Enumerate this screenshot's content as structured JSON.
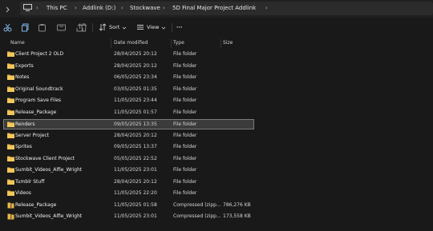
{
  "breadcrumbs": [
    "This PC",
    "Addlink (D:)",
    "Stockwave",
    "5D Final Major Project Addlink"
  ],
  "toolbar": {
    "sort_label": "Sort",
    "view_label": "View",
    "more_label": "···"
  },
  "columns": {
    "name": "Name",
    "date": "Date modified",
    "type": "Type",
    "size": "Size"
  },
  "files": [
    {
      "name": "Client Project 2 OLD",
      "date": "28/04/2025 20:12",
      "type": "File folder",
      "size": "",
      "icon": "folder-icon"
    },
    {
      "name": "Exports",
      "date": "28/04/2025 20:12",
      "type": "File folder",
      "size": "",
      "icon": "folder-icon"
    },
    {
      "name": "Notes",
      "date": "06/05/2025 23:34",
      "type": "File folder",
      "size": "",
      "icon": "folder-icon"
    },
    {
      "name": "Original Soundtrack",
      "date": "03/05/2025 01:35",
      "type": "File folder",
      "size": "",
      "icon": "folder-icon"
    },
    {
      "name": "Program Save Files",
      "date": "11/05/2025 23:44",
      "type": "File folder",
      "size": "",
      "icon": "folder-icon"
    },
    {
      "name": "Release_Package",
      "date": "11/05/2025 01:57",
      "type": "File folder",
      "size": "",
      "icon": "folder-icon"
    },
    {
      "name": "Renders",
      "date": "09/05/2025 13:35",
      "type": "File folder",
      "size": "",
      "icon": "folder-icon",
      "selected": true
    },
    {
      "name": "Server Project",
      "date": "28/04/2025 20:12",
      "type": "File folder",
      "size": "",
      "icon": "folder-icon"
    },
    {
      "name": "Sprites",
      "date": "09/05/2025 13:37",
      "type": "File folder",
      "size": "",
      "icon": "folder-icon"
    },
    {
      "name": "Stockwave Client Project",
      "date": "05/05/2025 22:52",
      "type": "File folder",
      "size": "",
      "icon": "folder-icon"
    },
    {
      "name": "Sumbit_Videos_Alfie_Wright",
      "date": "11/05/2025 23:01",
      "type": "File folder",
      "size": "",
      "icon": "folder-icon"
    },
    {
      "name": "Tumblr Stuff",
      "date": "28/04/2025 20:12",
      "type": "File folder",
      "size": "",
      "icon": "folder-icon"
    },
    {
      "name": "Videos",
      "date": "11/05/2025 22:20",
      "type": "File folder",
      "size": "",
      "icon": "folder-icon"
    },
    {
      "name": "Release_Package",
      "date": "11/05/2025 01:58",
      "type": "Compressed (zipp...",
      "size": "786,276 KB",
      "icon": "zip-folder-icon"
    },
    {
      "name": "Sumbit_Videos_Alfie_Wright",
      "date": "11/05/2025 23:01",
      "type": "Compressed (zipp...",
      "size": "173,558 KB",
      "icon": "zip-folder-icon"
    }
  ],
  "colors": {
    "background": "#191919",
    "folder": "#e8b84a",
    "selected_bg": "#3b3b3b"
  }
}
